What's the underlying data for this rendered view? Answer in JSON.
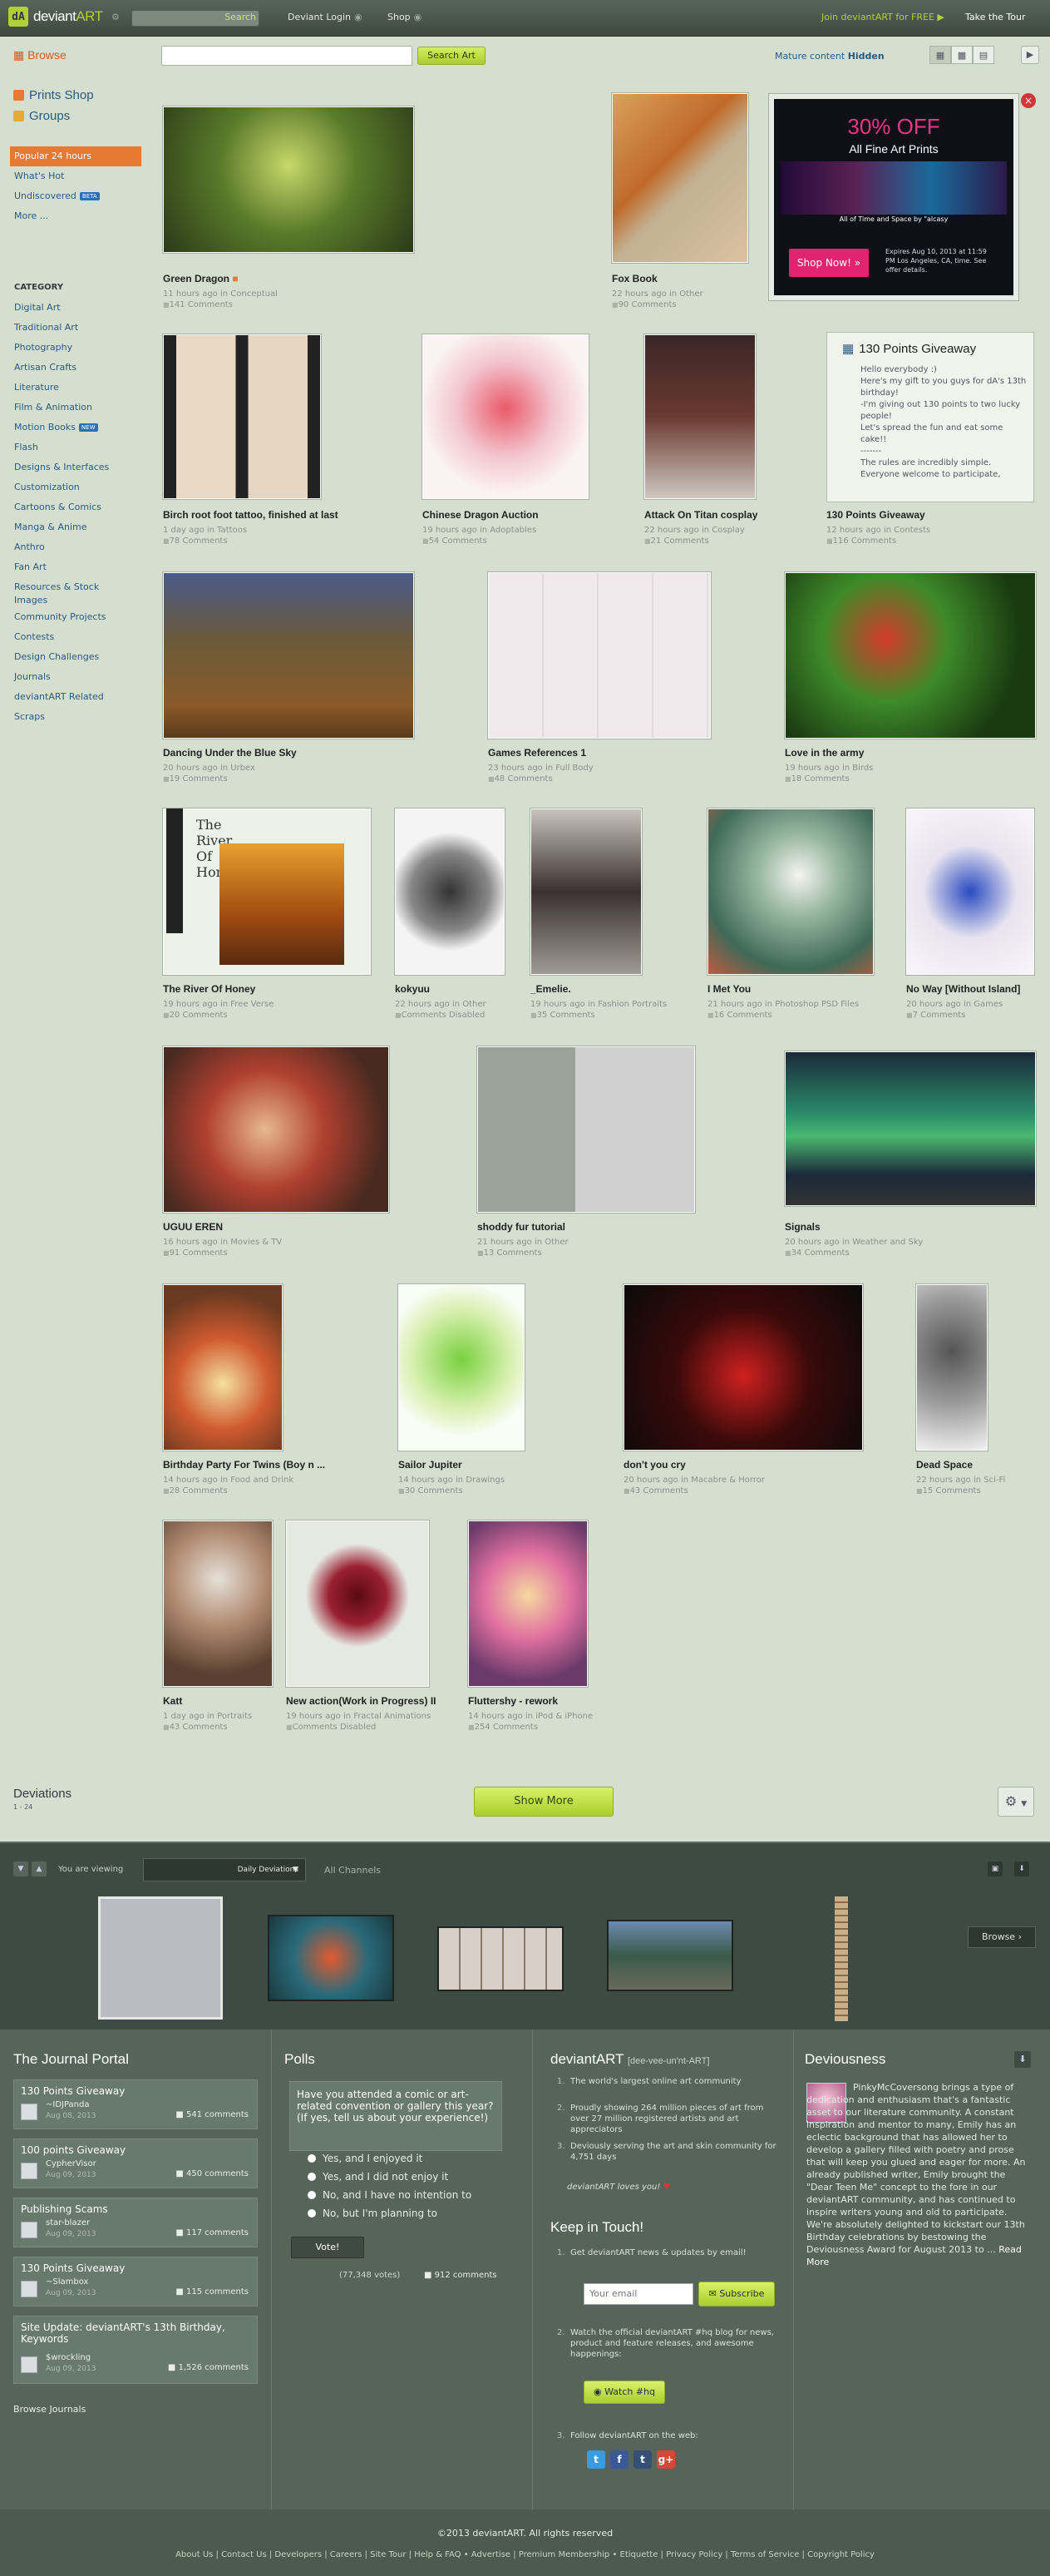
{
  "topbar": {
    "logo_mark": "dA",
    "logo_a": "deviant",
    "logo_b": "ART",
    "search_label": "Search",
    "login": "Deviant Login",
    "shop": "Shop",
    "join": "Join deviantART for FREE",
    "tour": "Take the Tour"
  },
  "sidebar": {
    "browse": "Browse",
    "prints": "Prints Shop",
    "groups": "Groups",
    "items": [
      "Popular 24 hours",
      "What's Hot",
      "Undiscovered",
      "More ..."
    ],
    "beta": "BETA",
    "category_heading": "CATEGORY",
    "categories": [
      "Digital Art",
      "Traditional Art",
      "Photography",
      "Artisan Crafts",
      "Literature",
      "Film & Animation",
      "Motion Books",
      "Flash",
      "Designs & Interfaces",
      "Customization",
      "Cartoons & Comics",
      "Manga & Anime",
      "Anthro",
      "Fan Art",
      "Resources & Stock Images",
      "Community Projects",
      "Contests",
      "Design Challenges",
      "Journals",
      "deviantART Related",
      "Scraps"
    ],
    "new_badge": "NEW"
  },
  "toolbar": {
    "search_button": "Search Art",
    "mature_label": "Mature content",
    "mature_value": "Hidden"
  },
  "deviations": [
    {
      "title": "Green Dragon",
      "meta": "11 hours ago in Conceptual",
      "comments": "141 Comments"
    },
    {
      "title": "Fox Book",
      "meta": "22 hours ago in Other",
      "comments": "90 Comments"
    },
    {
      "title": "Birch root foot tattoo, finished at last",
      "meta": "1 day ago in Tattoos",
      "comments": "78 Comments"
    },
    {
      "title": "Chinese Dragon Auction",
      "meta": "19 hours ago in Adoptables",
      "comments": "54 Comments"
    },
    {
      "title": "Attack On Titan cosplay",
      "meta": "22 hours ago in Cosplay",
      "comments": "21 Comments"
    },
    {
      "title": "130 Points Giveaway",
      "meta": "12 hours ago in Contests",
      "comments": "116 Comments"
    },
    {
      "title": "Dancing Under the Blue Sky",
      "meta": "20 hours ago in Urbex",
      "comments": "19 Comments"
    },
    {
      "title": "Games References 1",
      "meta": "23 hours ago in Full Body",
      "comments": "48 Comments"
    },
    {
      "title": "Love in the army",
      "meta": "19 hours ago in Birds",
      "comments": "18 Comments"
    },
    {
      "title": "The River Of Honey",
      "meta": "19 hours ago in Free Verse",
      "comments": "20 Comments"
    },
    {
      "title": "kokyuu",
      "meta": "22 hours ago in Other",
      "comments": "Comments Disabled"
    },
    {
      "title": "_Emelie.",
      "meta": "19 hours ago in Fashion Portraits",
      "comments": "35 Comments"
    },
    {
      "title": "I Met You",
      "meta": "21 hours ago in Photoshop PSD Files",
      "comments": "16 Comments"
    },
    {
      "title": "No Way [Without Island]",
      "meta": "20 hours ago in Games",
      "comments": "7 Comments"
    },
    {
      "title": "UGUU EREN",
      "meta": "16 hours ago in Movies & TV",
      "comments": "91 Comments"
    },
    {
      "title": "shoddy fur tutorial",
      "meta": "21 hours ago in Other",
      "comments": "13 Comments"
    },
    {
      "title": "Signals",
      "meta": "20 hours ago in Weather and Sky",
      "comments": "34 Comments"
    },
    {
      "title": "Birthday Party For Twins (Boy n ...",
      "meta": "14 hours ago in Food and Drink",
      "comments": "28 Comments"
    },
    {
      "title": "Sailor Jupiter",
      "meta": "14 hours ago in Drawings",
      "comments": "30 Comments"
    },
    {
      "title": "don't you cry",
      "meta": "20 hours ago in Macabre & Horror",
      "comments": "43 Comments"
    },
    {
      "title": "Dead Space",
      "meta": "22 hours ago in Sci-Fi",
      "comments": "15 Comments"
    },
    {
      "title": "Katt",
      "meta": "1 day ago in Portraits",
      "comments": "43 Comments"
    },
    {
      "title": "New action(Work in Progress) II",
      "meta": "19 hours ago in Fractal Animations",
      "comments": "Comments Disabled"
    },
    {
      "title": "Fluttershy - rework",
      "meta": "14 hours ago in iPod & iPhone",
      "comments": "254 Comments"
    }
  ],
  "ad": {
    "off": "30% OFF",
    "line": "All Fine Art Prints",
    "caption": "All of Time and Space by \"alcasy",
    "shop": "Shop Now! »",
    "expires": "Expires Aug 10, 2013 at 11:59 PM Los Angeles, CA, time. See offer details."
  },
  "giveaway": {
    "title": "130 Points Giveaway",
    "body": "Hello everybody :)\nHere's my gift to you guys for dA's 13th birthday!\n-I'm giving out 130 points to two lucky people!\nLet's spread the fun and eat some cake!!\n-------\nThe rules are incredibly simple. Everyone welcome to participate,"
  },
  "river_card_title": "The River Of Honey",
  "deviations_bar": {
    "title": "Deviations",
    "count": "1 - 24",
    "show_more": "Show More"
  },
  "strip": {
    "viewing": "You are viewing",
    "selected": "Daily Deviations",
    "all": "All Channels",
    "browse": "Browse ›"
  },
  "journal": {
    "heading": "The Journal Portal",
    "browse": "Browse Journals",
    "items": [
      {
        "title": "130 Points Giveaway",
        "author": "~IDJPanda",
        "date": "Aug 08, 2013",
        "comments": "541 comments"
      },
      {
        "title": "100 points Giveaway",
        "author": "CypherVisor",
        "date": "Aug 09, 2013",
        "comments": "450 comments"
      },
      {
        "title": "Publishing Scams",
        "author": "star-blazer",
        "date": "Aug 09, 2013",
        "comments": "117 comments"
      },
      {
        "title": "130 Points Giveaway",
        "author": "~Slambox",
        "date": "Aug 09, 2013",
        "comments": "115 comments"
      },
      {
        "title": "Site Update: deviantART's 13th Birthday, Keywords",
        "author": "$wrockling",
        "date": "Aug 09, 2013",
        "comments": "1,526 comments"
      }
    ]
  },
  "polls": {
    "heading": "Polls",
    "question": "Have you attended a comic or art-related convention or gallery this year? (If yes, tell us about your experience!)",
    "options": [
      "Yes, and I enjoyed it",
      "Yes, and I did not enjoy it",
      "No, and I have no intention to",
      "No, but I'm planning to"
    ],
    "vote": "Vote!",
    "votes": "(77,348 votes)",
    "comments": "912 comments"
  },
  "about": {
    "heading": "deviantART",
    "pron": "[dee-vee-un'nt-ART]",
    "facts": [
      "The world's largest online art community",
      "Proudly showing 264 million pieces of art from over 27 million registered artists and art appreciators",
      "Deviously serving the art and skin community for 4,751 days"
    ],
    "loves": "deviantART loves you!",
    "keep": "Keep in Touch!",
    "k1": "Get deviantART news & updates by email!",
    "email_placeholder": "Your email",
    "subscribe": "Subscribe",
    "k2": "Watch the official deviantART #hq blog for news, product and feature releases, and awesome happenings:",
    "watch": "Watch #hq",
    "k3": "Follow deviantART on the web:"
  },
  "deviousness": {
    "heading": "Deviousness",
    "text": "PinkyMcCoversong brings a type of dedication and enthusiasm that's a fantastic asset to our literature community. A constant inspiration and mentor to many, Emily has an eclectic background that has allowed her to develop a gallery filled with poetry and prose that will keep you glued and eager for more. An already published writer, Emily brought the \"Dear Teen Me\" concept to the fore in our deviantART community, and has continued to inspire writers young and old to participate. We're absolutely delighted to kickstart our 13th Birthday celebrations by bestowing the Deviousness Award for August 2013 to ...",
    "read_more": "Read More"
  },
  "footer": {
    "copyright": "©2013 deviantART. All rights reserved",
    "links": "About Us | Contact Us | Developers | Careers | Site Tour | Help & FAQ  •  Advertise | Premium Membership  •  Etiquette | Privacy Policy | Terms of Service | Copyright Policy"
  }
}
